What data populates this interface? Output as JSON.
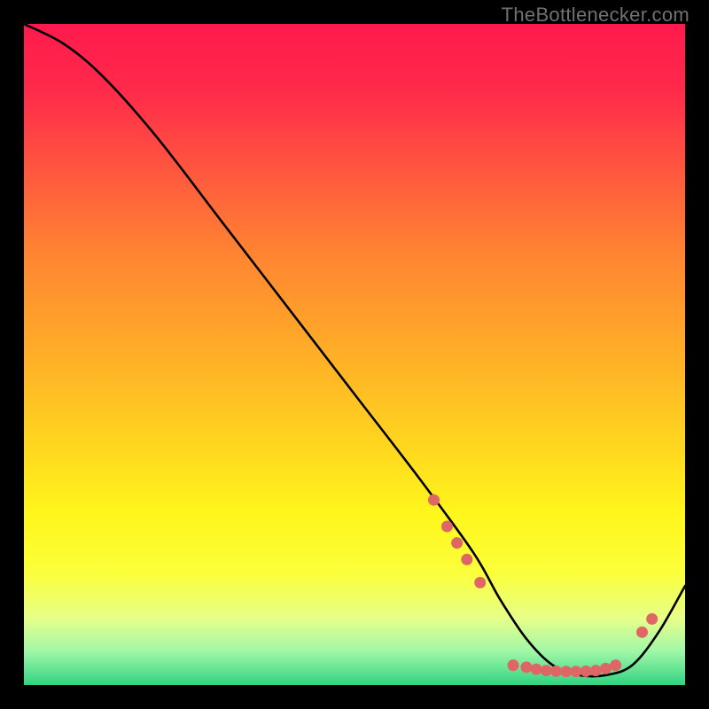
{
  "watermark": "TheBottlenecker.com",
  "chart_data": {
    "type": "line",
    "title": "",
    "xlabel": "",
    "ylabel": "",
    "xlim": [
      0,
      100
    ],
    "ylim": [
      0,
      100
    ],
    "series": [
      {
        "name": "curve",
        "x": [
          0,
          6,
          12,
          20,
          30,
          40,
          50,
          60,
          68,
          72,
          76,
          80,
          84,
          88,
          92,
          96,
          100
        ],
        "y": [
          100,
          97,
          92,
          83,
          70,
          57,
          44,
          31,
          20,
          13,
          7,
          3,
          1.5,
          1.5,
          3,
          8,
          15
        ]
      }
    ],
    "highlight_points": {
      "comment": "salmon dots along curve bottom",
      "points": [
        {
          "x": 62,
          "y": 28
        },
        {
          "x": 64,
          "y": 24
        },
        {
          "x": 65.5,
          "y": 21.5
        },
        {
          "x": 67,
          "y": 19
        },
        {
          "x": 69,
          "y": 15.5
        },
        {
          "x": 74,
          "y": 3
        },
        {
          "x": 76,
          "y": 2.7
        },
        {
          "x": 77.5,
          "y": 2.4
        },
        {
          "x": 79,
          "y": 2.2
        },
        {
          "x": 80.5,
          "y": 2.1
        },
        {
          "x": 82,
          "y": 2.05
        },
        {
          "x": 83.5,
          "y": 2.05
        },
        {
          "x": 85,
          "y": 2.1
        },
        {
          "x": 86.5,
          "y": 2.2
        },
        {
          "x": 88,
          "y": 2.5
        },
        {
          "x": 89.5,
          "y": 3
        },
        {
          "x": 93.5,
          "y": 8
        },
        {
          "x": 95,
          "y": 10
        }
      ]
    },
    "gradient_stops": [
      {
        "pos": 0,
        "color": "#ff1a4d"
      },
      {
        "pos": 10,
        "color": "#ff2a4a"
      },
      {
        "pos": 23,
        "color": "#ff5a3e"
      },
      {
        "pos": 35,
        "color": "#ff8531"
      },
      {
        "pos": 50,
        "color": "#ffae27"
      },
      {
        "pos": 63,
        "color": "#ffd41f"
      },
      {
        "pos": 74,
        "color": "#fff61c"
      },
      {
        "pos": 83,
        "color": "#fbff3a"
      },
      {
        "pos": 90,
        "color": "#e6ff8a"
      },
      {
        "pos": 95,
        "color": "#9ef7a8"
      },
      {
        "pos": 100,
        "color": "#30d380"
      }
    ],
    "colors": {
      "curve": "#000000",
      "dots": "#e06666",
      "frame": "#000000"
    }
  }
}
